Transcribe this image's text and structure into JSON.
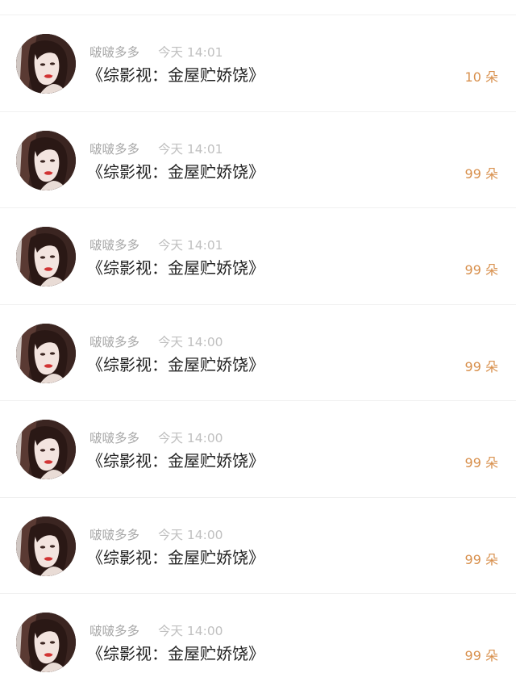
{
  "gift_list": {
    "items": [
      {
        "avatar_icon": "user-avatar-photo",
        "username": "啵啵多多",
        "time": "今天 14:01",
        "title": "《综影视：金屋贮娇饶》",
        "count": "10 朵"
      },
      {
        "avatar_icon": "user-avatar-photo",
        "username": "啵啵多多",
        "time": "今天 14:01",
        "title": "《综影视：金屋贮娇饶》",
        "count": "99 朵"
      },
      {
        "avatar_icon": "user-avatar-photo",
        "username": "啵啵多多",
        "time": "今天 14:01",
        "title": "《综影视：金屋贮娇饶》",
        "count": "99 朵"
      },
      {
        "avatar_icon": "user-avatar-photo",
        "username": "啵啵多多",
        "time": "今天 14:00",
        "title": "《综影视：金屋贮娇饶》",
        "count": "99 朵"
      },
      {
        "avatar_icon": "user-avatar-photo",
        "username": "啵啵多多",
        "time": "今天 14:00",
        "title": "《综影视：金屋贮娇饶》",
        "count": "99 朵"
      },
      {
        "avatar_icon": "user-avatar-photo",
        "username": "啵啵多多",
        "time": "今天 14:00",
        "title": "《综影视：金屋贮娇饶》",
        "count": "99 朵"
      },
      {
        "avatar_icon": "user-avatar-photo",
        "username": "啵啵多多",
        "time": "今天 14:00",
        "title": "《综影视：金屋贮娇饶》",
        "count": "99 朵"
      }
    ]
  },
  "colors": {
    "count_accent": "#d8904d",
    "meta_gray": "#a7a7a7",
    "title_text": "#222222",
    "divider": "#f0f0f0"
  }
}
